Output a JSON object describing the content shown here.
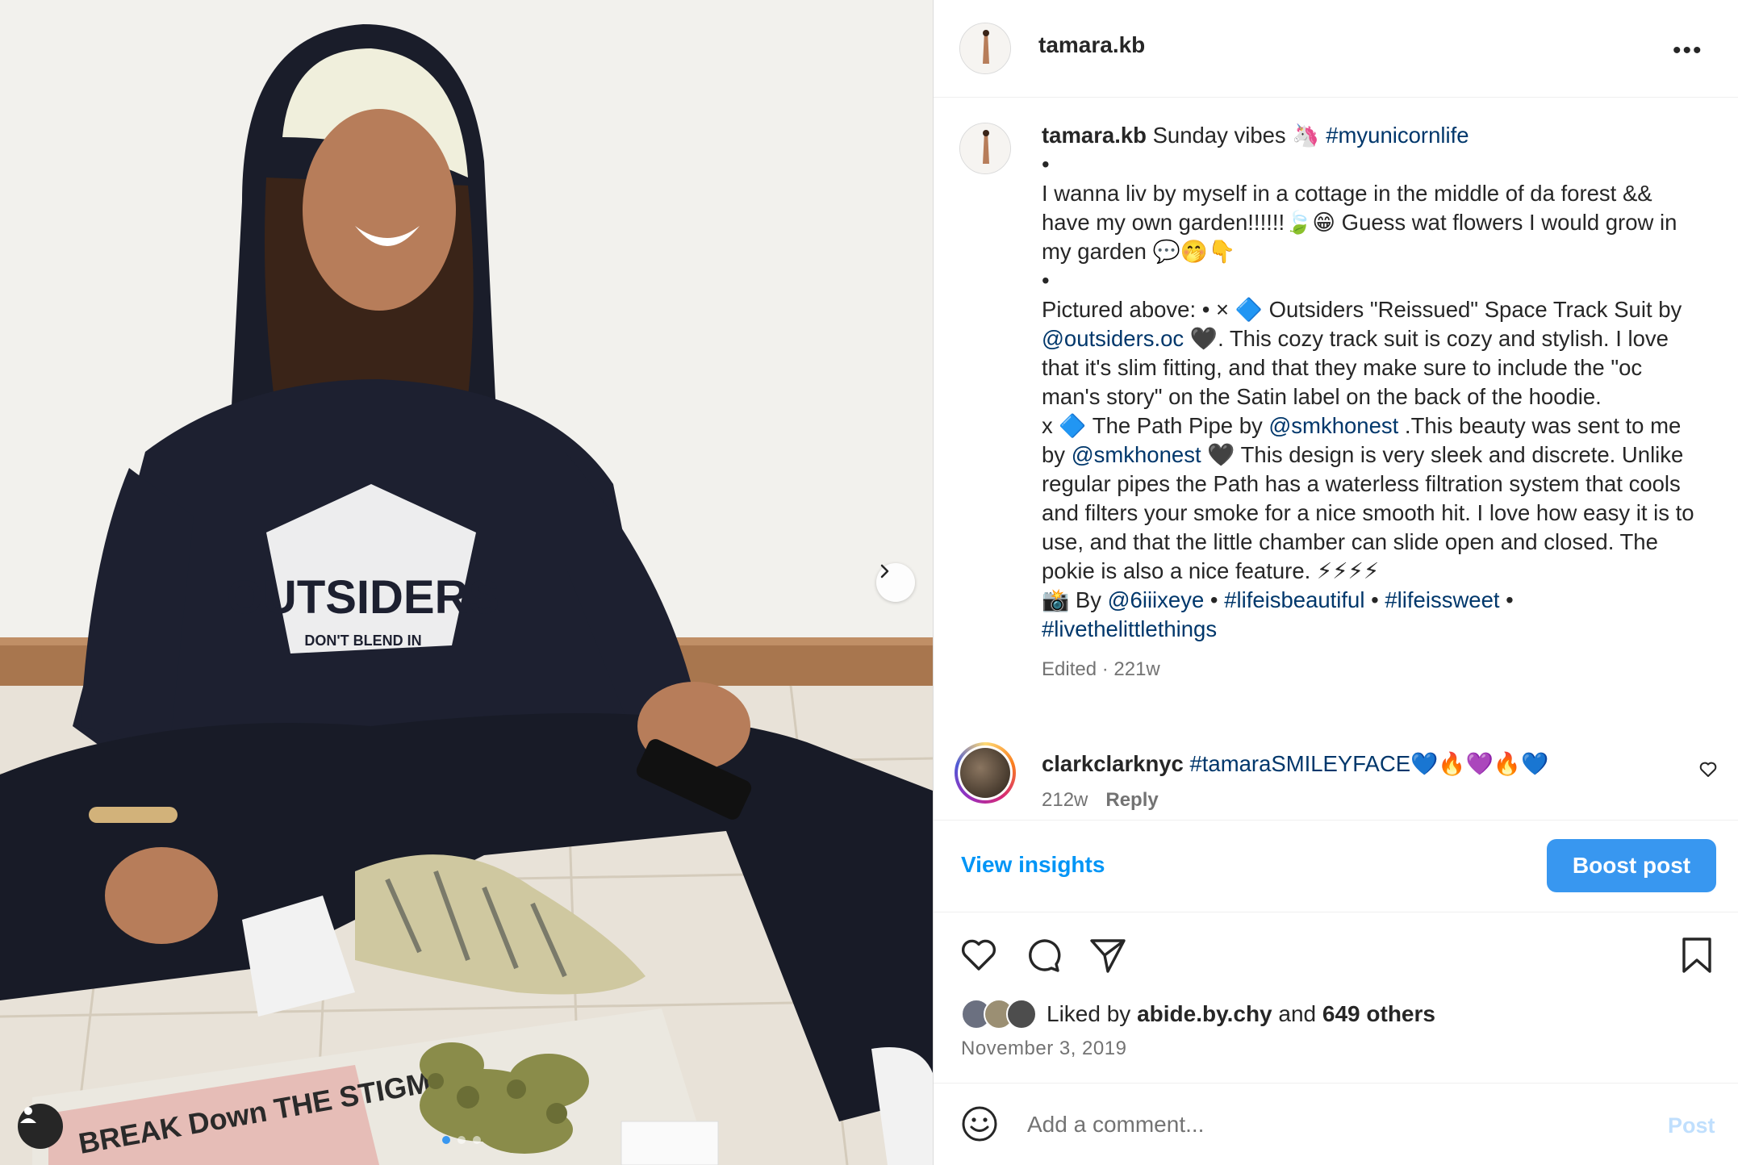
{
  "post": {
    "author": "tamara.kb",
    "more_label": "•••",
    "caption": {
      "author": "tamara.kb",
      "line1_text": " Sunday vibes 🦄 ",
      "line1_tag": "#myunicornlife",
      "bullet1": "•",
      "para1": "I wanna liv by myself in a cottage in the middle of da forest && have my own garden!!!!!!🍃😁 Guess wat flowers I would grow in my garden 💬🤭👇",
      "bullet2": "•",
      "p2_a": "Pictured above: • × 🔷 Outsiders \"Reissued\" Space Track Suit by ",
      "p2_mention": "@outsiders.oc",
      "p2_b": " 🖤. This cozy track suit is cozy and stylish. I love that it's slim fitting, and that they make sure to include the \"oc man's story\" on the Satin label on the back of the hoodie.",
      "p3_a": "x 🔷  The Path Pipe by ",
      "p3_mention1": "@smkhonest",
      "p3_b": " .This beauty was sent to me by ",
      "p3_mention2": "@smkhonest",
      "p3_c": " 🖤 This design is very sleek and discrete. Unlike regular pipes the Path has a waterless filtration system that cools and filters your smoke for a nice smooth hit. I love how easy it is to use, and that the little chamber can slide open and closed. The pokie is also a nice feature. ⚡⚡⚡⚡",
      "p4_a": "📸 By ",
      "p4_mention": "@6iiixeye",
      "p4_sep1": " • ",
      "p4_tag1": "#lifeisbeautiful",
      "p4_sep2": " • ",
      "p4_tag2": "#lifeissweet",
      "p4_sep3": " •",
      "p4_tag3": "#livethelittlethings",
      "meta": "Edited · 221w"
    },
    "comment": {
      "author": "clarkclarknyc",
      "tag": "#tamaraSMILEYFACE",
      "emojis": "💙🔥💜🔥💙",
      "age": "212w",
      "reply_label": "Reply"
    },
    "view_insights_label": "View insights",
    "boost_label": "Boost post",
    "likes": {
      "prefix": "Liked by ",
      "user": "abide.by.chy",
      "middle": " and ",
      "others": "649 others"
    },
    "date": "November 3, 2019",
    "add_comment_placeholder": "Add a comment...",
    "post_label": "Post"
  },
  "photo": {
    "shirt_text": "OUTSIDERS",
    "shirt_subtext": "DON'T BLEND IN",
    "newspaper_text": "BREAK Down THE STIGMAS"
  },
  "carousel": {
    "count": 3,
    "active_index": 0
  },
  "colors": {
    "accent": "#0095f6",
    "boost": "#3897f0",
    "link": "#00376b",
    "muted": "#737373"
  },
  "icons": [
    "chevron-right-icon",
    "user-tag-icon",
    "more-icon",
    "heart-icon",
    "comment-icon",
    "share-icon",
    "bookmark-icon",
    "emoji-icon"
  ]
}
